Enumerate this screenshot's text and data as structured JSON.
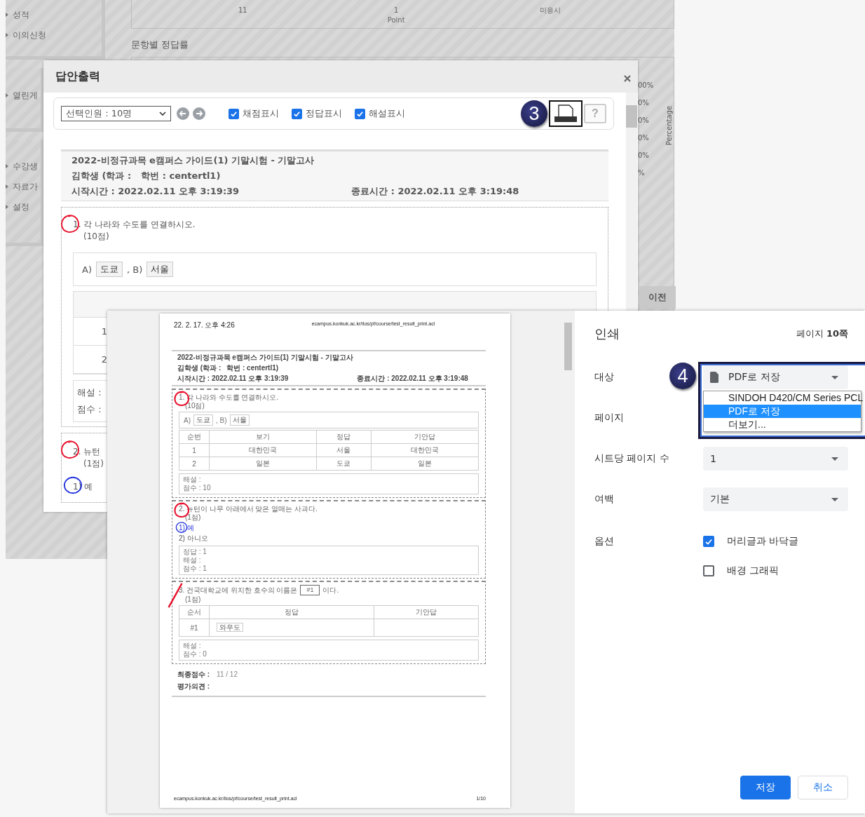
{
  "background_page": {
    "sidebar_groups": [
      {
        "items": [
          {
            "label": "성적"
          },
          {
            "label": "이의신청"
          }
        ]
      },
      {
        "items": [
          {
            "label": "열린게"
          }
        ]
      },
      {
        "items": [
          {
            "label": "수강생"
          },
          {
            "label": "자료가"
          },
          {
            "label": "설정"
          }
        ]
      }
    ],
    "chart_labels": [
      {
        "value": "11"
      },
      {
        "value": "1",
        "unit": "Point"
      },
      {
        "value": "미응시"
      }
    ],
    "section_title": "문항별 정답률",
    "percent_labels": [
      "00%",
      "0%",
      "0%",
      "0%",
      "0%",
      "%"
    ],
    "axis_title": "Percentage",
    "prev_button": "이전"
  },
  "answer_dialog": {
    "title": "답안출력",
    "toolbar": {
      "select": "선택인원 : 10명",
      "checkboxes": [
        {
          "label": "채점표시",
          "checked": true
        },
        {
          "label": "정답표시",
          "checked": true
        },
        {
          "label": "해설표시",
          "checked": true
        }
      ],
      "step_badge": "3",
      "help": "?"
    },
    "exam_title": "2022-비정규과목 e캠퍼스 가이드(1) 기말시험 - 기말고사",
    "student": "김학생 (학과 :",
    "student_id": "학번 : centertl1)",
    "start_time": "시작시간 : 2022.02.11 오후 3:19:39",
    "end_time": "종료시간 : 2022.02.11 오후 3:19:48",
    "question_1": {
      "correct": true,
      "text": "1. 각 나라와 수도를 연결하시오.",
      "points": "(10점)",
      "answer": [
        {
          "label": "A)",
          "value": "도쿄"
        },
        {
          "label": ", B)",
          "value": "서울"
        }
      ],
      "rows": [
        "1",
        "2"
      ],
      "feedback": [
        "해설 :",
        "점수 :"
      ]
    },
    "question_2": {
      "correct": true,
      "text": "2. 뉴턴",
      "points": "(1점)",
      "option": {
        "label": "1) 예",
        "selected": true
      }
    }
  },
  "print_dialog": {
    "preview": {
      "header_date": "22. 2. 17. 오후 4:26",
      "header_url": "ecampus.konkuk.ac.kr/ilos/pf/course/test_result_print.acl",
      "exam_title": "2022-비정규과목 e캠퍼스 가이드(1) 기말시험 - 기말고사",
      "student": "김학생 (학과 :",
      "student_id": "학번 : centertl1)",
      "start_time": "시작시간 : 2022.02.11 오후 3:19:39",
      "end_time": "종료시간 : 2022.02.11 오후 3:19:48",
      "questions": [
        {
          "kind": "matching",
          "correct": true,
          "text": "1. 각 나라와 수도를 연결하시오.",
          "points": "(10점)",
          "answer": [
            {
              "label": "A)",
              "value": "도쿄"
            },
            {
              "label": ", B)",
              "value": "서울"
            }
          ],
          "columns": [
            "순번",
            "보기",
            "정답",
            "기안답"
          ],
          "rows": [
            [
              "1",
              "대한민국",
              "서울",
              "대한민국"
            ],
            [
              "2",
              "일본",
              "도쿄",
              "일본"
            ]
          ],
          "feedback": [
            "해설 :",
            "점수 : 10"
          ]
        },
        {
          "kind": "choice",
          "correct": true,
          "text": "2. 뉴턴이 나무 아래에서 맞은 열매는 사과다.",
          "points": "(1점)",
          "options": [
            {
              "label": "1) 예",
              "selected": true
            },
            {
              "label": "2) 아니오",
              "selected": false
            }
          ],
          "feedback": [
            "정답 : 1",
            "해설 :",
            "점수 : 1"
          ]
        },
        {
          "kind": "blank",
          "correct": false,
          "text": "3. 건국대학교에 위치한 호수의 이름은",
          "blank": "#1",
          "text_after": "이다.",
          "points": "(1점)",
          "columns": [
            "순서",
            "정답",
            "기안답"
          ],
          "rows": [
            [
              "#1",
              "와우도"
            ]
          ],
          "feedback": [
            "해설 :",
            "점수 : 0"
          ]
        }
      ],
      "final_score_label": "최종점수 :",
      "final_score": "11 / 12",
      "comment_label": "평가의견 :",
      "footer_url": "ecampus.konkuk.ac.kr/ilos/pf/course/test_result_print.acl",
      "page_number": "1/10"
    },
    "settings": {
      "title": "인쇄",
      "page_count": "페이지 **10쪽**",
      "step_badge": "4",
      "rows": [
        {
          "kind": "destination",
          "label": "대상",
          "value": "PDF로 저장",
          "expanded": true,
          "options": [
            {
              "label": "SINDOH D420/CM Series PCL",
              "selected": false
            },
            {
              "label": "PDF로 저장",
              "selected": true
            },
            {
              "label": "더보기...",
              "selected": false
            }
          ]
        },
        {
          "kind": "pages",
          "label": "페이지"
        },
        {
          "kind": "select",
          "label": "시트당 페이지 수",
          "value": "1"
        },
        {
          "kind": "select",
          "label": "여백",
          "value": "기본"
        },
        {
          "kind": "checkbox",
          "label": "옵션",
          "option": "머리글과 바닥글",
          "checked": true
        },
        {
          "kind": "checkbox",
          "option": "배경 그래픽",
          "checked": false
        }
      ],
      "buttons": [
        {
          "kind": "primary",
          "label": "저장"
        },
        {
          "kind": "secondary",
          "label": "취소"
        }
      ]
    }
  }
}
